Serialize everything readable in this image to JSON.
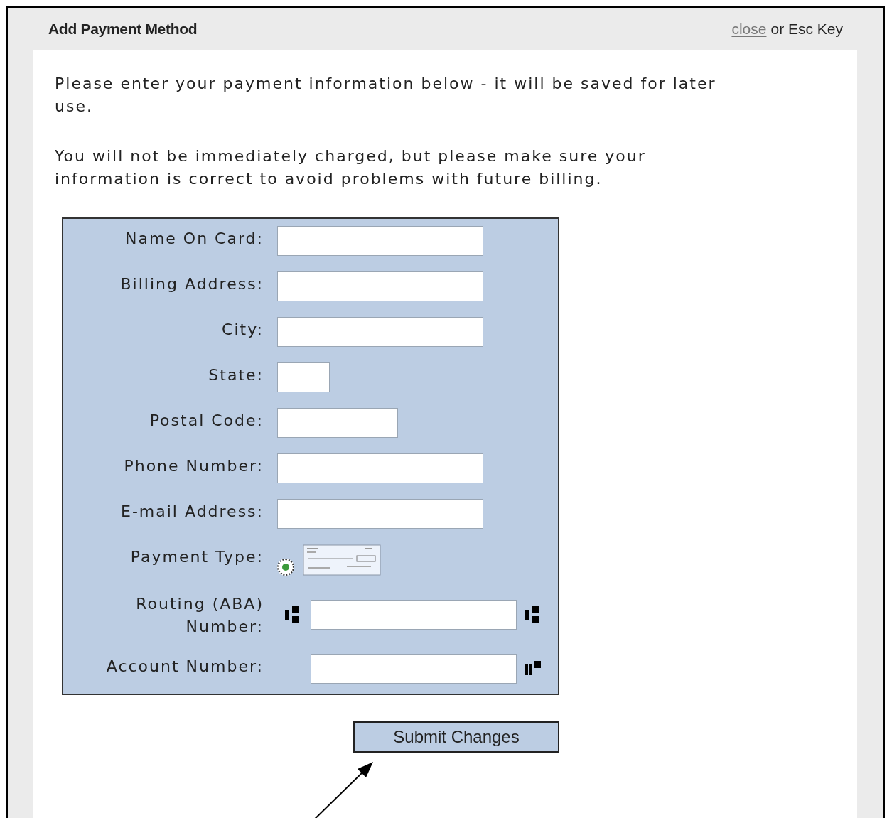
{
  "dialog": {
    "title": "Add Payment Method",
    "close_link": "close",
    "close_hint": "or Esc Key"
  },
  "intro": [
    "Please enter your payment information below - it will be saved for later use.",
    "You will not be immediately charged, but please make sure your information is correct to avoid problems with future billing."
  ],
  "fields": [
    {
      "kind": "text",
      "label": "Name On Card:"
    },
    {
      "kind": "text",
      "label": "Billing Address:"
    },
    {
      "kind": "text",
      "label": "City:"
    },
    {
      "kind": "short",
      "label": "State:"
    },
    {
      "kind": "medium",
      "label": "Postal Code:"
    },
    {
      "kind": "text",
      "label": "Phone Number:"
    },
    {
      "kind": "text",
      "label": "E-mail Address:"
    },
    {
      "kind": "radio",
      "label": "Payment Type:",
      "selected": true
    },
    {
      "kind": "routing",
      "label": "Routing (ABA) Number:"
    },
    {
      "kind": "account",
      "label": "Account Number:"
    }
  ],
  "submit_button": "Submit Changes"
}
